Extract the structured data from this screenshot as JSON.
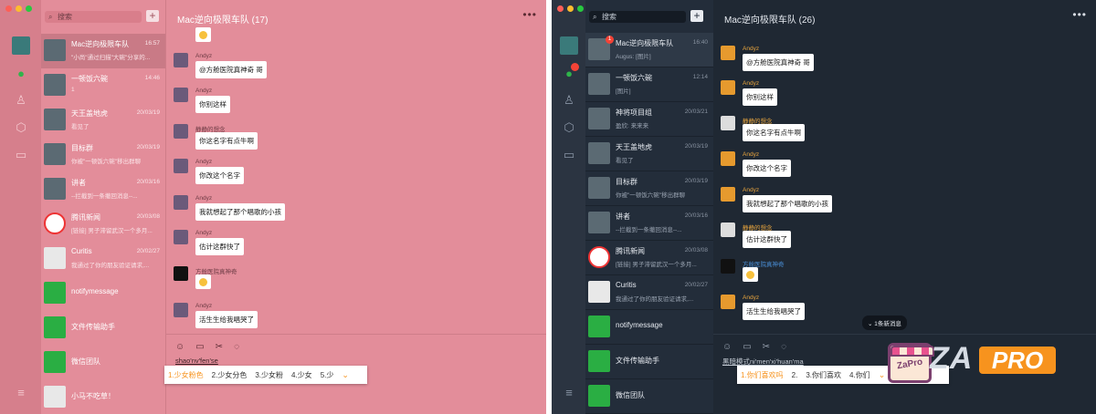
{
  "left_window": {
    "theme": "pink",
    "search_placeholder": "搜索",
    "plus_label": "+",
    "chat_title": "Mac逆向极限车队 (17)",
    "more_label": "•••",
    "chats": [
      {
        "name": "Mac逆向极限车队",
        "time": "16:57",
        "preview": "\"小尚\"通过扫描\"大碗\"分享的..."
      },
      {
        "name": "一顿饭六碗",
        "time": "14:46",
        "preview": "1"
      },
      {
        "name": "天王盖地虎",
        "time": "20/03/19",
        "preview": "看见了"
      },
      {
        "name": "目标群",
        "time": "20/03/19",
        "preview": "你被\"一顿饭六碗\"移出群聊"
      },
      {
        "name": "讲者",
        "time": "20/03/16",
        "preview": "--拦截到一条撤回消息--..."
      },
      {
        "name": "腾讯新闻",
        "time": "20/03/08",
        "preview": "[链接] 男子滞留武汉一个多月..."
      },
      {
        "name": "Curitis",
        "time": "20/02/27",
        "preview": "我通过了你的朋友验证请求,..."
      },
      {
        "name": "notifymessage",
        "time": "",
        "preview": ""
      },
      {
        "name": "文件传输助手",
        "time": "",
        "preview": ""
      },
      {
        "name": "微信团队",
        "time": "",
        "preview": ""
      },
      {
        "name": "小马不吃草！",
        "time": "",
        "preview": ""
      }
    ],
    "messages": [
      {
        "sender": "Andyz",
        "text": "@方舱医院真神奇 哥"
      },
      {
        "sender": "Andyz",
        "text": "你别这样"
      },
      {
        "sender": "静静的想念",
        "text": "你这名字有点牛啊"
      },
      {
        "sender": "Andyz",
        "text": "你改这个名字"
      },
      {
        "sender": "Andyz",
        "text": "我就想起了那个唱歌的小孩"
      },
      {
        "sender": "Andyz",
        "text": "估计这群快了"
      },
      {
        "sender": "方舱医院真神奇",
        "text": ""
      },
      {
        "sender": "Andyz",
        "text": "活生生给我唱哭了"
      }
    ],
    "pinyin": "shao'nv'fen'se",
    "candidates": [
      "1.少女粉色",
      "2.少女分色",
      "3.少女粉",
      "4.少女",
      "5.少"
    ]
  },
  "right_window": {
    "theme": "dark",
    "search_placeholder": "搜索",
    "plus_label": "+",
    "chat_title": "Mac逆向极限车队 (26)",
    "more_label": "•••",
    "chats": [
      {
        "name": "Mac逆向极限车队",
        "time": "16:40",
        "preview": "Augus: [图片]",
        "badge": "1"
      },
      {
        "name": "一顿饭六碗",
        "time": "12:14",
        "preview": "[图片]"
      },
      {
        "name": "神将项目组",
        "time": "20/03/21",
        "preview": "盈欣: 来来来"
      },
      {
        "name": "天王盖地虎",
        "time": "20/03/19",
        "preview": "看见了"
      },
      {
        "name": "目标群",
        "time": "20/03/19",
        "preview": "你被\"一顿饭六碗\"移出群聊"
      },
      {
        "name": "讲者",
        "time": "20/03/16",
        "preview": "--拦截到一条撤回消息--..."
      },
      {
        "name": "腾讯新闻",
        "time": "20/03/08",
        "preview": "[链接] 男子滞留武汉一个多月..."
      },
      {
        "name": "Curitis",
        "time": "20/02/27",
        "preview": "我通过了你的朋友验证请求,..."
      },
      {
        "name": "notifymessage",
        "time": "",
        "preview": ""
      },
      {
        "name": "文件传输助手",
        "time": "",
        "preview": ""
      },
      {
        "name": "微信团队",
        "time": "",
        "preview": ""
      }
    ],
    "messages": [
      {
        "sender": "Andyz",
        "text": "@方舱医院真神奇 哥"
      },
      {
        "sender": "Andyz",
        "text": "你别这样"
      },
      {
        "sender": "静静的想念",
        "text": "你这名字有点牛啊"
      },
      {
        "sender": "Andyz",
        "text": "你改这个名字"
      },
      {
        "sender": "Andyz",
        "text": "我就想起了那个唱歌的小孩"
      },
      {
        "sender": "静静的想念",
        "text": "估计这群快了"
      },
      {
        "sender": "方舱医院真神奇",
        "text": ""
      },
      {
        "sender": "Andyz",
        "text": "活生生给我唱哭了"
      }
    ],
    "new_messages_label": "1条新消息",
    "pinyin": "黑暗模式ni'men'xi'huan'ma",
    "candidates": [
      "1.你们喜欢吗",
      "2.",
      "3.你们喜欢",
      "4.你们"
    ]
  },
  "watermark": {
    "badge": "ZaPro",
    "text_za": "ZA",
    "text_pro": "PRO"
  },
  "colors": {
    "pink_bg": "#e38d9a",
    "dark_bg": "#1f2833",
    "accent_green": "#2fb44a",
    "ime_orange": "#f7931e"
  }
}
